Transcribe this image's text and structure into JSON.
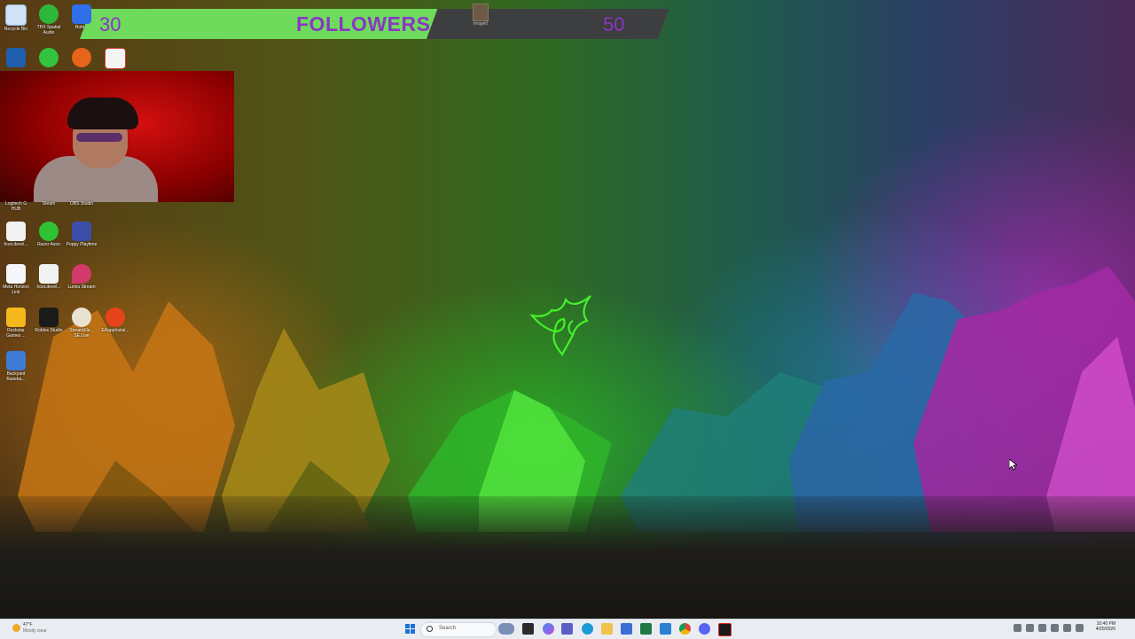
{
  "followers_widget": {
    "current": "30",
    "label": "FOLLOWERS",
    "goal": "50",
    "progress": 0.6,
    "colors": {
      "fill": "#6fdb5d",
      "track": "#3d3e3f",
      "text": "#8a36c4"
    }
  },
  "floating_image": {
    "label": "image0"
  },
  "desktop_icons": [
    {
      "label": "Recycle Bin",
      "icon": "recycle-bin-icon"
    },
    {
      "label": "THX Spatial Audio",
      "icon": "thx-audio-icon"
    },
    {
      "label": "Robl...",
      "icon": "roblox-icon"
    },
    {
      "label": "",
      "icon": "settings-icon"
    },
    {
      "label": "",
      "icon": "razer-synapse-icon"
    },
    {
      "label": "",
      "icon": "orange-app-icon"
    },
    {
      "label": "",
      "icon": "pdf-icon"
    },
    {
      "label": "Logitech G HUB",
      "icon": "logitech-icon"
    },
    {
      "label": "Steam",
      "icon": "steam-icon"
    },
    {
      "label": "OBS Studio",
      "icon": "obs-icon"
    },
    {
      "label": "host.devel...",
      "icon": "file-icon"
    },
    {
      "label": "Razer Axon",
      "icon": "razer-axon-icon"
    },
    {
      "label": "Poppy Playtime",
      "icon": "poppy-playtime-icon"
    },
    {
      "label": "Meta Horizon Link",
      "icon": "meta-icon"
    },
    {
      "label": "host.devel...",
      "icon": "file-icon"
    },
    {
      "label": "Lumia Stream",
      "icon": "lumia-icon"
    },
    {
      "label": "Rockstar Games ...",
      "icon": "rockstar-icon"
    },
    {
      "label": "Roblox Studio",
      "icon": "roblox-studio-icon"
    },
    {
      "label": "StreamEle... SE.Live",
      "icon": "streamelements-icon"
    },
    {
      "label": "EAappInstal...",
      "icon": "ea-icon"
    },
    {
      "label": "Backyard Baseba...",
      "icon": "backyard-baseball-icon"
    }
  ],
  "taskbar": {
    "weather_temp": "47°F",
    "weather_condition": "Mostly clear",
    "search_placeholder": "Search",
    "time": "10:40 PM",
    "date": "4/20/2026",
    "pinned_apps": [
      "widgets-icon",
      "file-explorer-icon",
      "copilot-icon",
      "teams-icon",
      "edge-icon",
      "folder-icon",
      "store-icon",
      "excel-icon",
      "mail-icon",
      "chrome-icon",
      "discord-icon",
      "razer-icon"
    ]
  }
}
